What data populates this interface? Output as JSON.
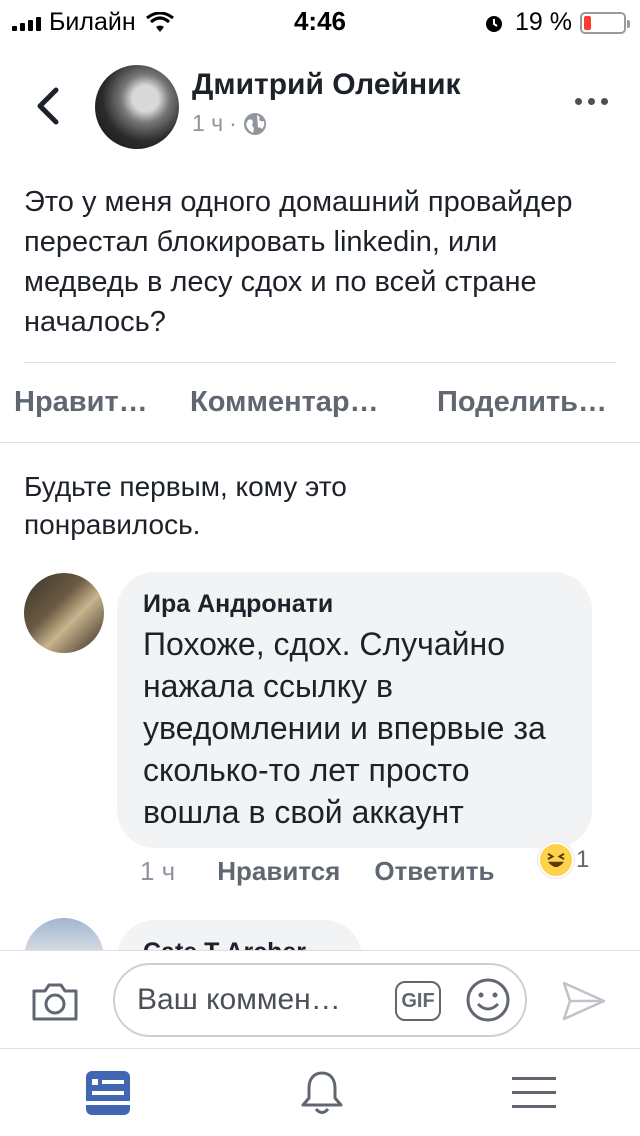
{
  "status_bar": {
    "carrier": "Билайн",
    "time": "4:46",
    "battery": "19 %",
    "battery_level": 0.19
  },
  "post": {
    "author": "Дмитрий Олейник",
    "time": "1 ч",
    "separator": "·",
    "text": "Это у меня одного домашний провайдер перестал блокировать linkedin, или медведь в лесу сдох и по всей стране началось?"
  },
  "actions": {
    "like": "Нравит…",
    "comment": "Комментар…",
    "share": "Поделить…"
  },
  "first_like": "Будьте первым, кому это понравилось.",
  "comments": [
    {
      "author": "Ира Андронати",
      "text": "Похоже, сдох. Случайно нажала ссылку в уведомлении и впервые за сколько-то лет просто вошла в свой аккаунт",
      "time": "1 ч",
      "like_label": "Нравится",
      "reply_label": "Ответить",
      "reaction_count": "1",
      "reaction_icon": "laughing-emoji-icon"
    },
    {
      "author": "Cate T Archer"
    }
  ],
  "composer": {
    "placeholder": "Ваш коммен…",
    "gif_label": "GIF"
  },
  "colors": {
    "text": "#1d2129",
    "secondary": "#90949c",
    "action": "#606770",
    "bubble": "#f2f3f5",
    "tab_active": "#4267b2"
  }
}
